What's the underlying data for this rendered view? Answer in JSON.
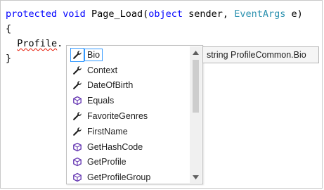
{
  "code": {
    "line1": {
      "kw1": "protected",
      "kw2": "void",
      "method": "Page_Load(",
      "kw3": "object",
      "param1": "sender,",
      "type1": "EventArgs",
      "param2": "e)"
    },
    "line2": "{",
    "line3_prefix": "  ",
    "line3_ident": "Profile",
    "line3_dot": ".",
    "line4": "}"
  },
  "completion_list": {
    "items": [
      {
        "label": "Bio",
        "icon": "property-wrench-icon",
        "selected": true
      },
      {
        "label": "Context",
        "icon": "property-wrench-icon"
      },
      {
        "label": "DateOfBirth",
        "icon": "property-wrench-icon"
      },
      {
        "label": "Equals",
        "icon": "method-cube-icon"
      },
      {
        "label": "FavoriteGenres",
        "icon": "property-wrench-icon"
      },
      {
        "label": "FirstName",
        "icon": "property-wrench-icon"
      },
      {
        "label": "GetHashCode",
        "icon": "method-cube-icon"
      },
      {
        "label": "GetProfile",
        "icon": "method-cube-icon"
      },
      {
        "label": "GetProfileGroup",
        "icon": "method-cube-icon"
      }
    ]
  },
  "tooltip": {
    "text": "string ProfileCommon.Bio"
  },
  "colors": {
    "keyword": "#0000ff",
    "type": "#2b91af",
    "squiggle": "#e51400",
    "selection_border": "#3399ff",
    "method_icon": "#6a3cb4"
  }
}
